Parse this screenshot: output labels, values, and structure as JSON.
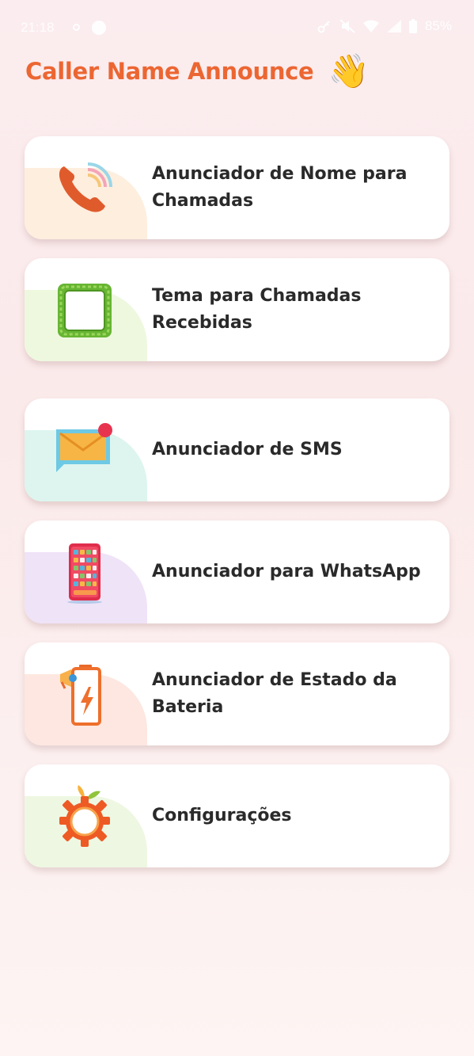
{
  "status_bar": {
    "time": "21:18",
    "battery": "85%"
  },
  "header": {
    "title": "Caller Name Announce",
    "wave_emoji": "👋"
  },
  "menu": {
    "items": [
      {
        "label": "Anunciador de Nome para Chamadas",
        "icon": "phone-call-icon",
        "blob_color": "#fdeede"
      },
      {
        "label": "Tema para Chamadas Recebidas",
        "icon": "theme-frame-icon",
        "blob_color": "#eef8df"
      },
      {
        "label": "Anunciador de SMS",
        "icon": "sms-envelope-icon",
        "blob_color": "#ddf5ee"
      },
      {
        "label": "Anunciador para WhatsApp",
        "icon": "smartphone-icon",
        "blob_color": "#efe3f8"
      },
      {
        "label": "Anunciador de Estado da Bateria",
        "icon": "battery-announcer-icon",
        "blob_color": "#fde7e0"
      },
      {
        "label": "Configurações",
        "icon": "settings-gear-icon",
        "blob_color": "#eef7e2"
      }
    ]
  },
  "colors": {
    "title": "#ec6632",
    "card_background": "#ffffff",
    "label_text": "#2a2a2a"
  }
}
